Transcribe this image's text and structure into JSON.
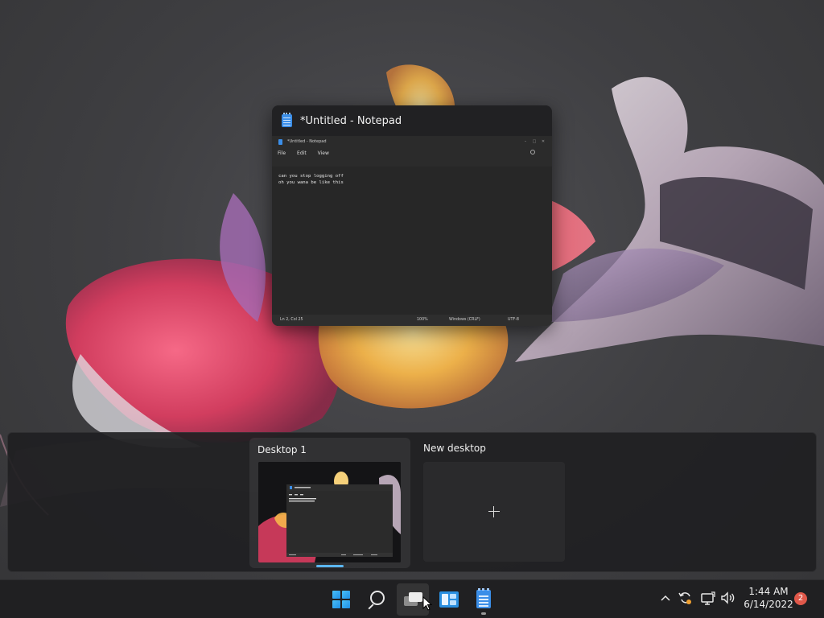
{
  "task_view": {
    "window_title": "*Untitled - Notepad",
    "notepad": {
      "titlebar_text": "*Untitled - Notepad",
      "menu": [
        "File",
        "Edit",
        "View"
      ],
      "lines": [
        "can you stop logging off",
        "oh you wana be like this"
      ],
      "status": {
        "position": "Ln 2, Col 25",
        "zoom": "100%",
        "line_ending": "Windows (CRLF)",
        "encoding": "UTF-8"
      }
    }
  },
  "desktops": {
    "items": [
      {
        "label": "Desktop 1",
        "active": true
      }
    ],
    "new_label": "New desktop"
  },
  "taskbar": {
    "icons": [
      "start-icon",
      "search-icon",
      "task-view-icon",
      "widgets-icon",
      "notepad-icon"
    ],
    "tray": {
      "icons": [
        "chevron-up-icon",
        "sync-icon",
        "network-icon",
        "volume-icon"
      ],
      "time": "1:44 AM",
      "date": "6/14/2022",
      "notification_count": "2"
    }
  },
  "colors": {
    "accent": "#5bb6f0",
    "taskbar": "#202022",
    "badge": "#e0584a"
  }
}
